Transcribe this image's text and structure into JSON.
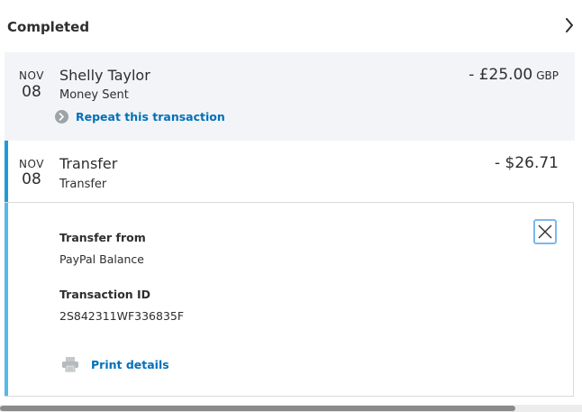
{
  "section": {
    "title": "Completed",
    "chevron_icon": "chevron-right-icon"
  },
  "transactions": [
    {
      "month": "NOV",
      "day": "08",
      "name": "Shelly Taylor",
      "type": "Money Sent",
      "amount": "- £25.00",
      "currency": "GBP",
      "repeat_icon": "chevron-right-circle-icon",
      "repeat_label": "Repeat this transaction"
    },
    {
      "month": "NOV",
      "day": "08",
      "name": "Transfer",
      "type": "Transfer",
      "amount": "- $26.71"
    }
  ],
  "details": {
    "transfer_from_label": "Transfer from",
    "transfer_from_value": "PayPal Balance",
    "transaction_id_label": "Transaction ID",
    "transaction_id_value": "2S842311WF336835F",
    "print_icon": "printer-icon",
    "print_label": "Print details",
    "close_icon": "close-icon"
  },
  "colors": {
    "accent_blue": "#0070ba",
    "selected_bar": "#1f9bd7",
    "row_highlight": "#f2f4f8"
  }
}
